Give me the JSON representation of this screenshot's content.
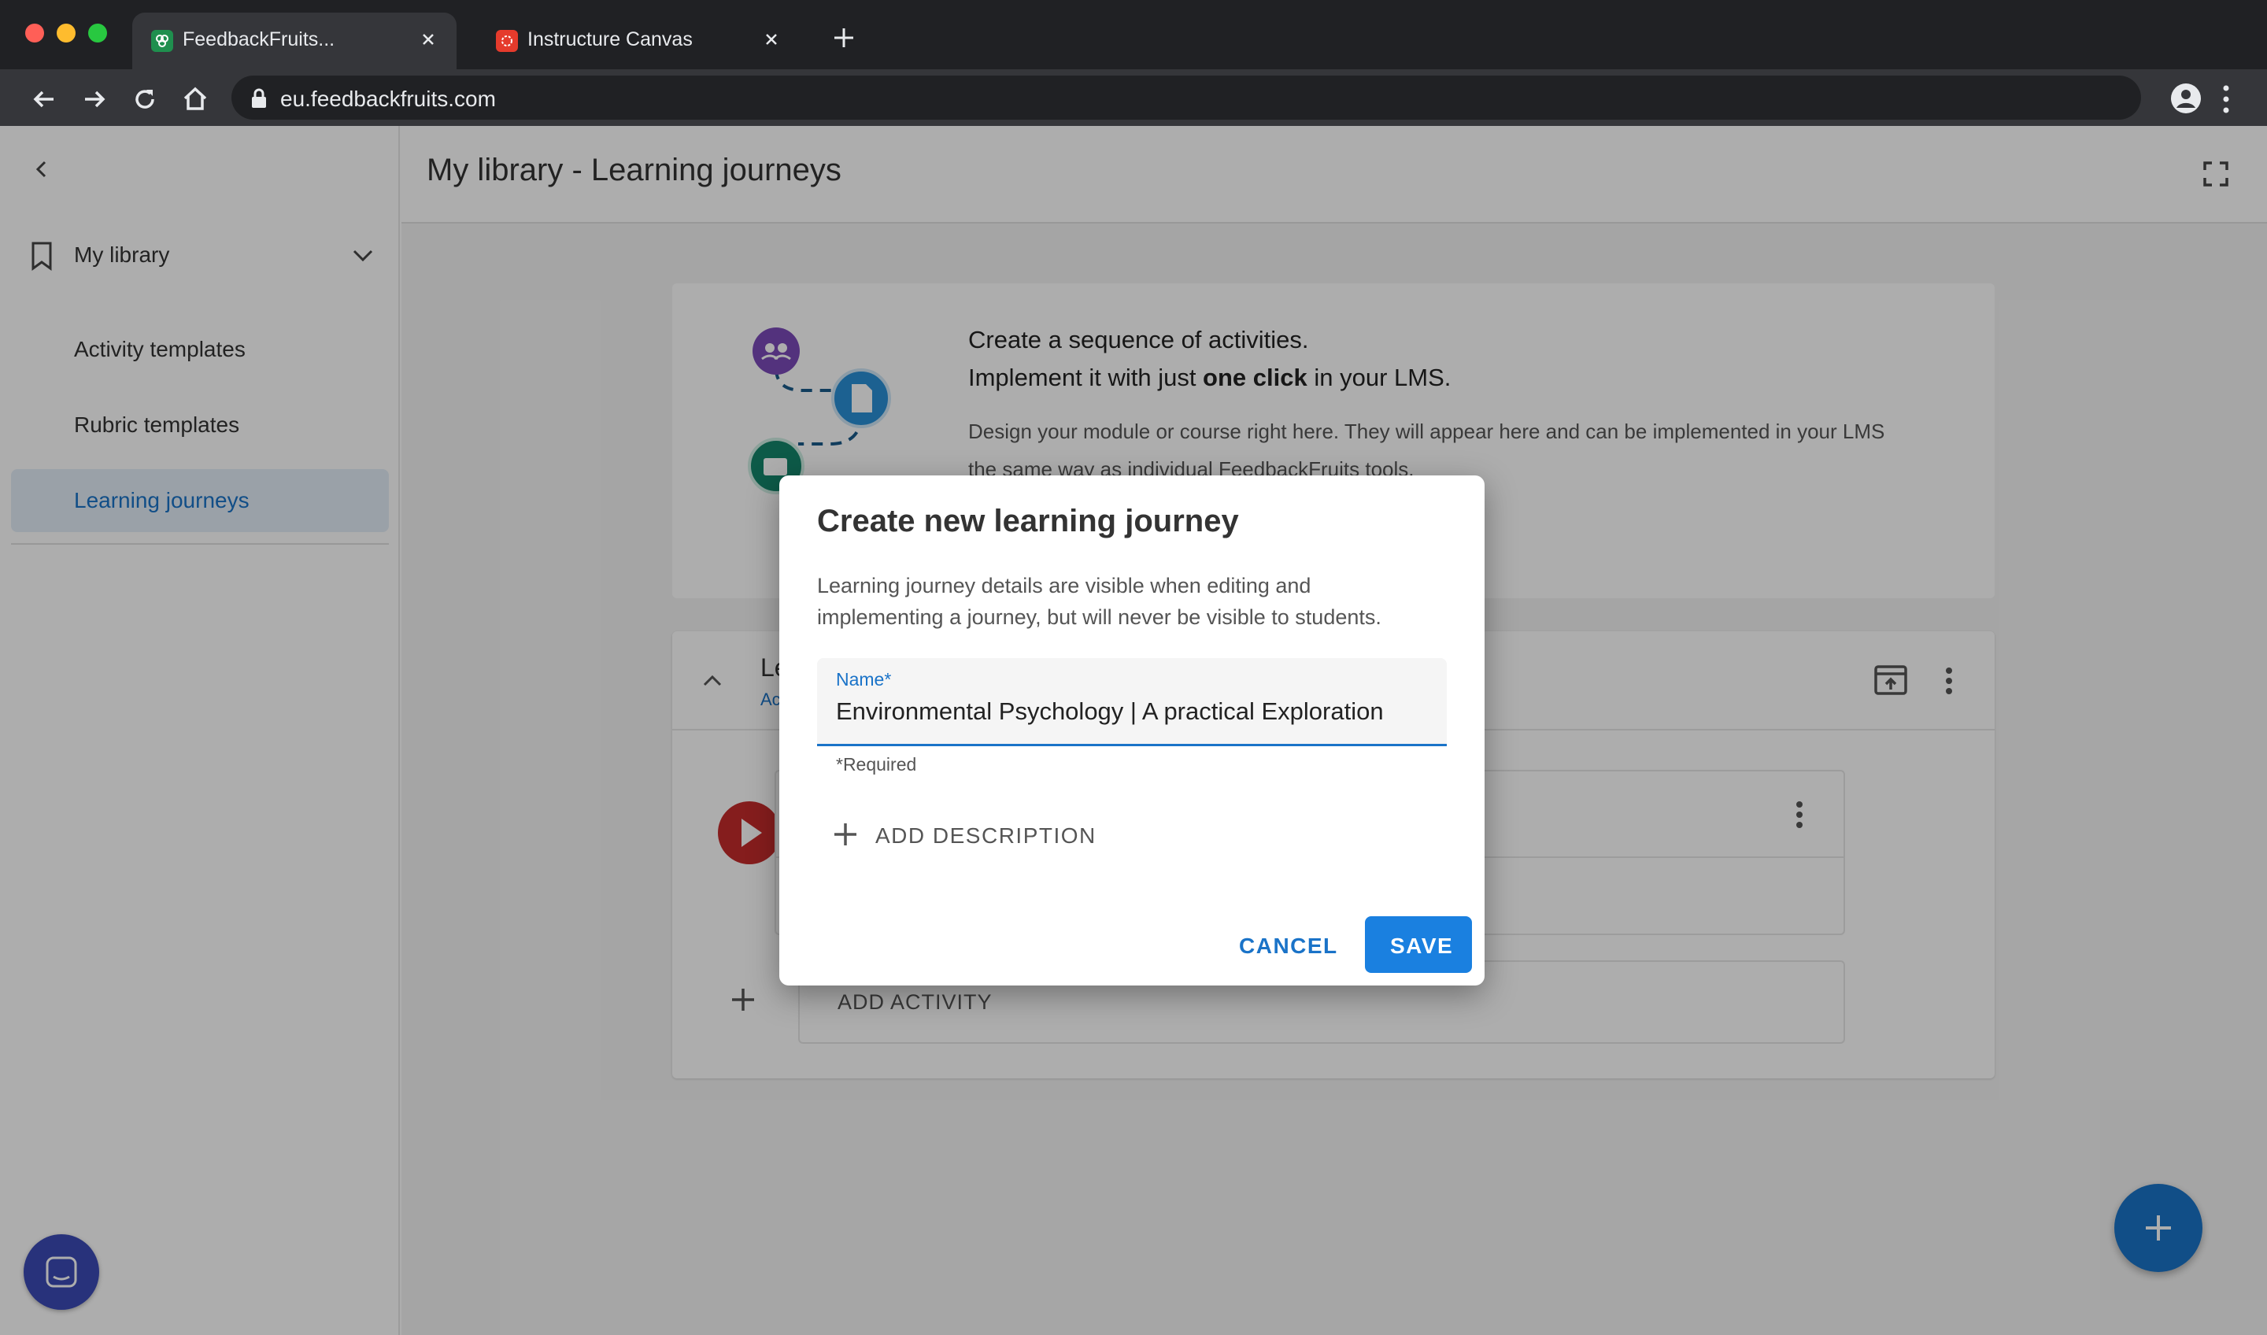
{
  "browser": {
    "tabs": [
      {
        "title": "FeedbackFruits...",
        "active": true
      },
      {
        "title": "Instructure Canvas",
        "active": false
      }
    ],
    "url": "eu.feedbackfruits.com"
  },
  "sidebar": {
    "section_label": "My library",
    "items": [
      {
        "label": "Activity templates",
        "active": false
      },
      {
        "label": "Rubric templates",
        "active": false
      },
      {
        "label": "Learning journeys",
        "active": true
      }
    ]
  },
  "main": {
    "title": "My library - Learning journeys",
    "banner": {
      "line1": "Create a sequence of activities.",
      "line2_pre": "Implement it with just ",
      "line2_bold": "one click",
      "line2_post": " in your LMS.",
      "description": "Design your module or course right here. They will appear here and can be implemented in your LMS the same way as individual FeedbackFruits tools."
    },
    "journey": {
      "title_partial": "Le",
      "subtitle_partial": "Ac",
      "add_activity_label": "ADD ACTIVITY"
    }
  },
  "dialog": {
    "title": "Create new learning journey",
    "text": "Learning journey details are visible when editing and implementing a journey, but will never be visible to students.",
    "field_label": "Name*",
    "field_value": "Environmental Psychology | A practical Exploration",
    "required_note": "*Required",
    "add_description_label": "ADD DESCRIPTION",
    "cancel_label": "CANCEL",
    "save_label": "SAVE"
  },
  "colors": {
    "accent": "#1a73c8",
    "chrome_dark": "#202124",
    "chrome_toolbar": "#35363a",
    "play_red": "#c52b2b",
    "chat_fab": "#3b4bb5"
  },
  "icons": [
    "close-icon",
    "plus-icon",
    "back-arrow-icon",
    "forward-arrow-icon",
    "reload-icon",
    "home-icon",
    "lock-icon",
    "profile-icon",
    "kebab-menu-icon",
    "chevron-left-icon",
    "bookmark-icon",
    "chevron-down-icon",
    "fullscreen-icon",
    "chevron-up-icon",
    "open-in-icon",
    "play-icon",
    "chat-icon"
  ]
}
